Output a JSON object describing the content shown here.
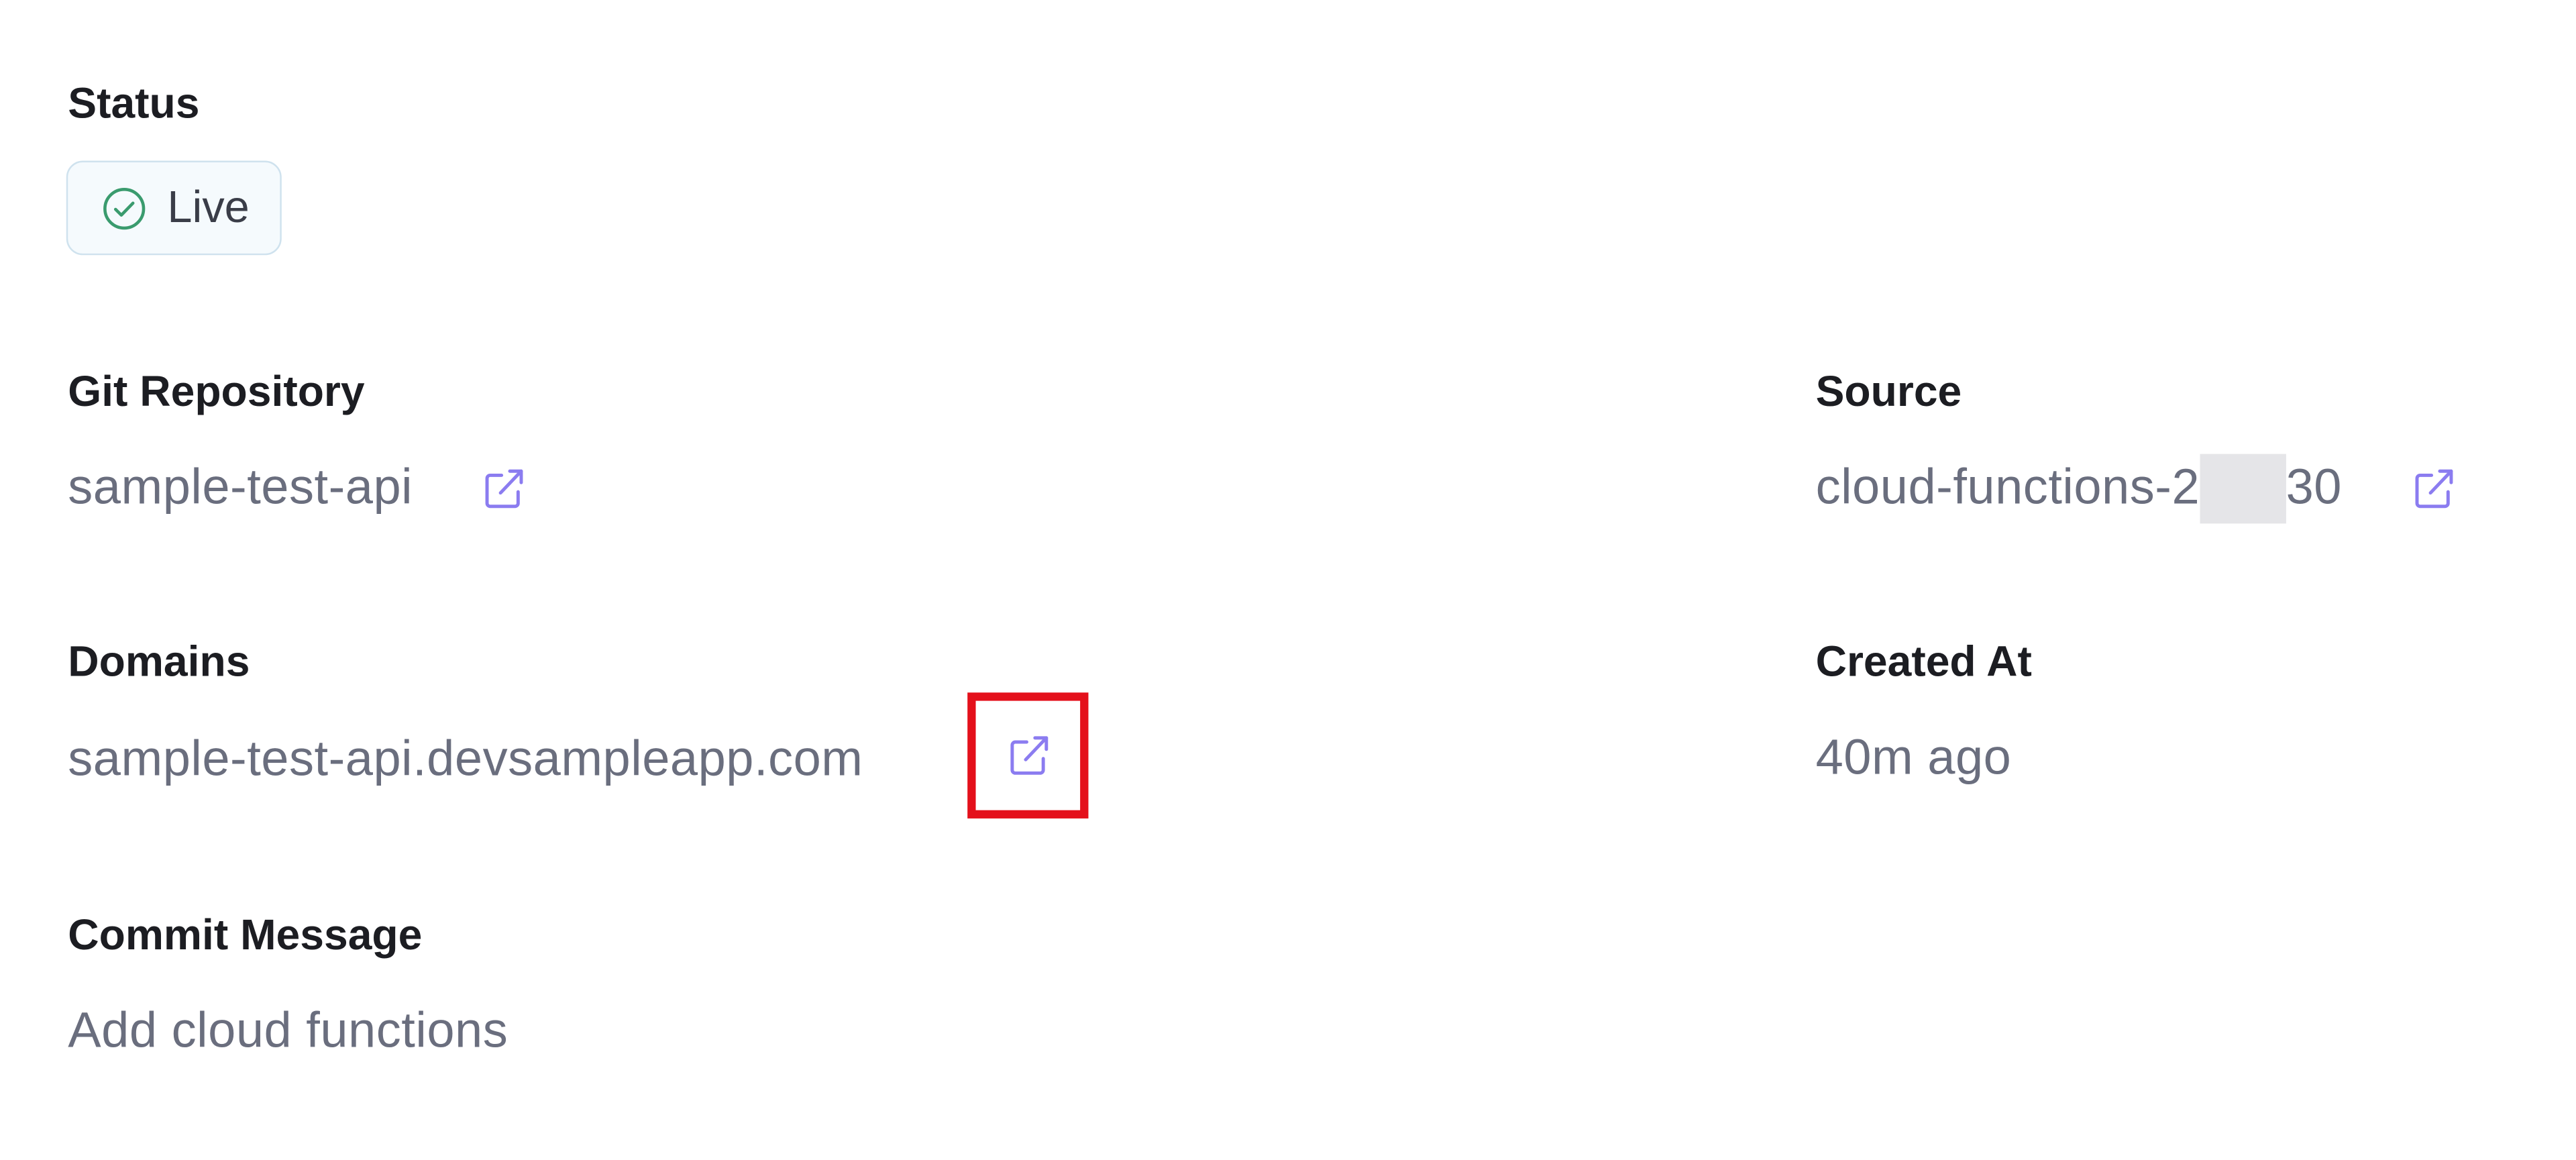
{
  "status": {
    "label": "Status",
    "badge_text": "Live",
    "badge_icon": "check-circle-icon",
    "accent_color": "#3a9b6e"
  },
  "git_repository": {
    "label": "Git Repository",
    "value": "sample-test-api",
    "link_icon": "external-link-icon"
  },
  "source": {
    "label": "Source",
    "value_prefix": "cloud-functions-2",
    "value_suffix": "30",
    "link_icon": "external-link-icon"
  },
  "domains": {
    "label": "Domains",
    "value": "sample-test-api.devsampleapp.com",
    "link_icon": "external-link-icon",
    "highlight_color": "#e4101b"
  },
  "created_at": {
    "label": "Created At",
    "value": "40m ago"
  },
  "commit_message": {
    "label": "Commit Message",
    "value": "Add cloud functions"
  },
  "colors": {
    "label_text": "#1c1d22",
    "value_text": "#6a6e7e",
    "link_icon": "#8b7cf0"
  }
}
